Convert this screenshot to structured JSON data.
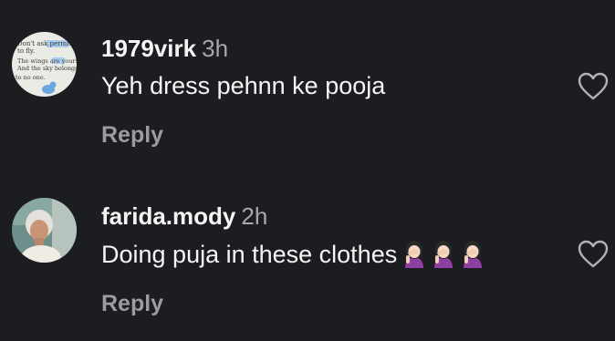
{
  "comments": [
    {
      "username": "1979virk",
      "timestamp": "3h",
      "text": "Yeh dress pehnn ke pooja",
      "reply_label": "Reply",
      "avatar": {
        "lines": [
          "Don't ask permission",
          "to fly.",
          "The wings are yours.",
          "And the sky belongs",
          "to no one."
        ],
        "background": "#e9ebe4",
        "accent": "#6aa6e0"
      }
    },
    {
      "username": "farida.mody",
      "timestamp": "2h",
      "text": "Doing puja in these clothes",
      "emojis": [
        "woman-facepalming",
        "woman-facepalming",
        "woman-facepalming"
      ],
      "reply_label": "Reply"
    }
  ],
  "colors": {
    "background": "#1b1d21",
    "text": "#f5f5f5",
    "secondary": "#a8a8a8",
    "reply": "#9a9ca0"
  }
}
